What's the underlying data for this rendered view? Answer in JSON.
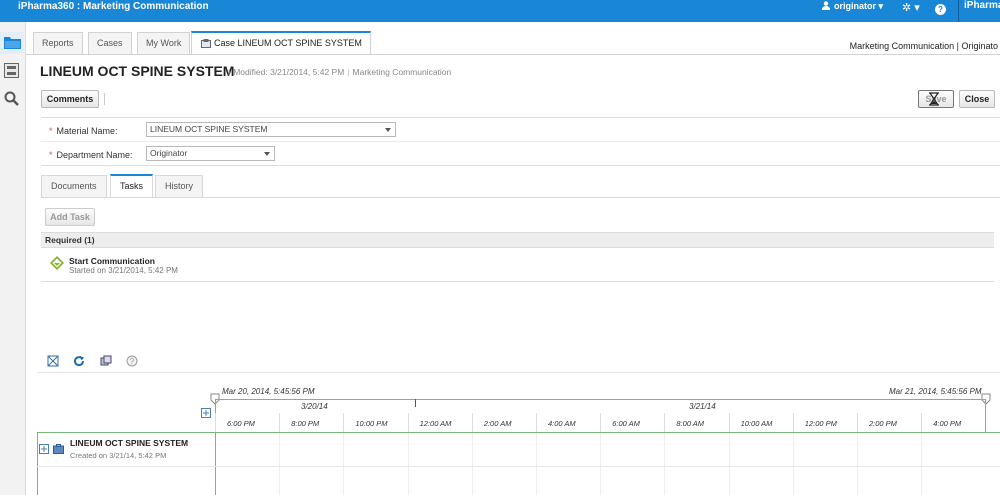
{
  "app": {
    "title": "iPharma360 : Marketing Communication",
    "user": "originator",
    "brand": "iPharma"
  },
  "nav_tabs": [
    {
      "label": "Reports"
    },
    {
      "label": "Cases"
    },
    {
      "label": "My Work"
    },
    {
      "label": "Case LINEUM OCT SPINE SYSTEM"
    }
  ],
  "breadcrumb": "Marketing Communication | Originato",
  "case": {
    "title": "LINEUM OCT SPINE SYSTEM",
    "modified_label": "Modified:",
    "modified_value": "3/21/2014, 5:42 PM",
    "solution": "Marketing Communication"
  },
  "toolbar": {
    "comments_label": "Comments",
    "save_label": "Save",
    "close_label": "Close"
  },
  "form": {
    "material_label": "Material Name:",
    "material_value": "LINEUM OCT SPINE SYSTEM",
    "department_label": "Department Name:",
    "department_value": "Originator",
    "required_marker": "*"
  },
  "subtabs": [
    {
      "label": "Documents"
    },
    {
      "label": "Tasks"
    },
    {
      "label": "History"
    }
  ],
  "tasks": {
    "add_task_label": "Add Task",
    "required_header": "Required (1)",
    "items": [
      {
        "name": "Start Communication",
        "status": "Started on 3/21/2014, 5:42 PM"
      }
    ]
  },
  "timeline": {
    "range_start": "Mar 20, 2014, 5:45:56 PM",
    "range_end": "Mar 21, 2014, 5:45:56 PM",
    "day1": "3/20/14",
    "day2": "3/21/14",
    "hours": [
      "6:00 PM",
      "8:00 PM",
      "10:00 PM",
      "12:00 AM",
      "2:00 AM",
      "4:00 AM",
      "6:00 AM",
      "8:00 AM",
      "10:00 AM",
      "12:00 PM",
      "2:00 PM",
      "4:00 PM"
    ],
    "row": {
      "name": "LINEUM OCT SPINE SYSTEM",
      "created": "Created on 3/21/14, 5:42 PM"
    }
  },
  "colors": {
    "accent": "#1a87d6",
    "timeline_border": "#7ab87a"
  }
}
